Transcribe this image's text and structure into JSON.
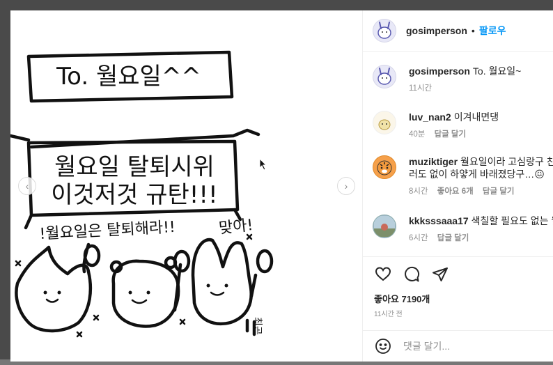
{
  "post": {
    "author": "gosimperson",
    "follow_label": "팔로우",
    "separator": "•"
  },
  "artwork": {
    "sign_top": "To. 월요일^^",
    "banner_line1": "월요일 탈퇴시위",
    "banner_line2": "이것저것 규탄!!!",
    "chant_left": "!월요일은 탈퇴해라!!",
    "chant_right": "맞아!",
    "signature": "최곤"
  },
  "comments": [
    {
      "user": "gosimperson",
      "text": "To. 월요일~",
      "time": "11시간",
      "likes": "",
      "reply": "",
      "avatar": "bunny"
    },
    {
      "user": "luv_nan2",
      "text": "이겨내면댕",
      "time": "40분",
      "likes": "",
      "reply": "답글 달기",
      "avatar": "dog"
    },
    {
      "user": "muziktiger",
      "text": "월요일이라 고심랑구 친구들",
      "text2": "러도 없이 하얗게 바래졌당구…😖",
      "time": "8시간",
      "likes": "좋아요 6개",
      "reply": "답글 달기",
      "avatar": "tiger"
    },
    {
      "user": "kkksssaaa17",
      "text": "색칠할 필요도 없는 월요일",
      "time": "6시간",
      "likes": "",
      "reply": "답글 달기",
      "avatar": "photo"
    }
  ],
  "actions": {
    "likes_text": "좋아요 7190개",
    "timestamp": "11시간 전"
  },
  "comment_input": {
    "placeholder": "댓글 달기..."
  },
  "icons": {
    "like": "heart-icon",
    "comment": "comment-icon",
    "share": "send-icon",
    "emoji": "emoji-icon",
    "prev": "chevron-left-icon",
    "next": "chevron-right-icon"
  },
  "colors": {
    "follow_blue": "#0095f6",
    "meta_gray": "#8e8e8e"
  }
}
